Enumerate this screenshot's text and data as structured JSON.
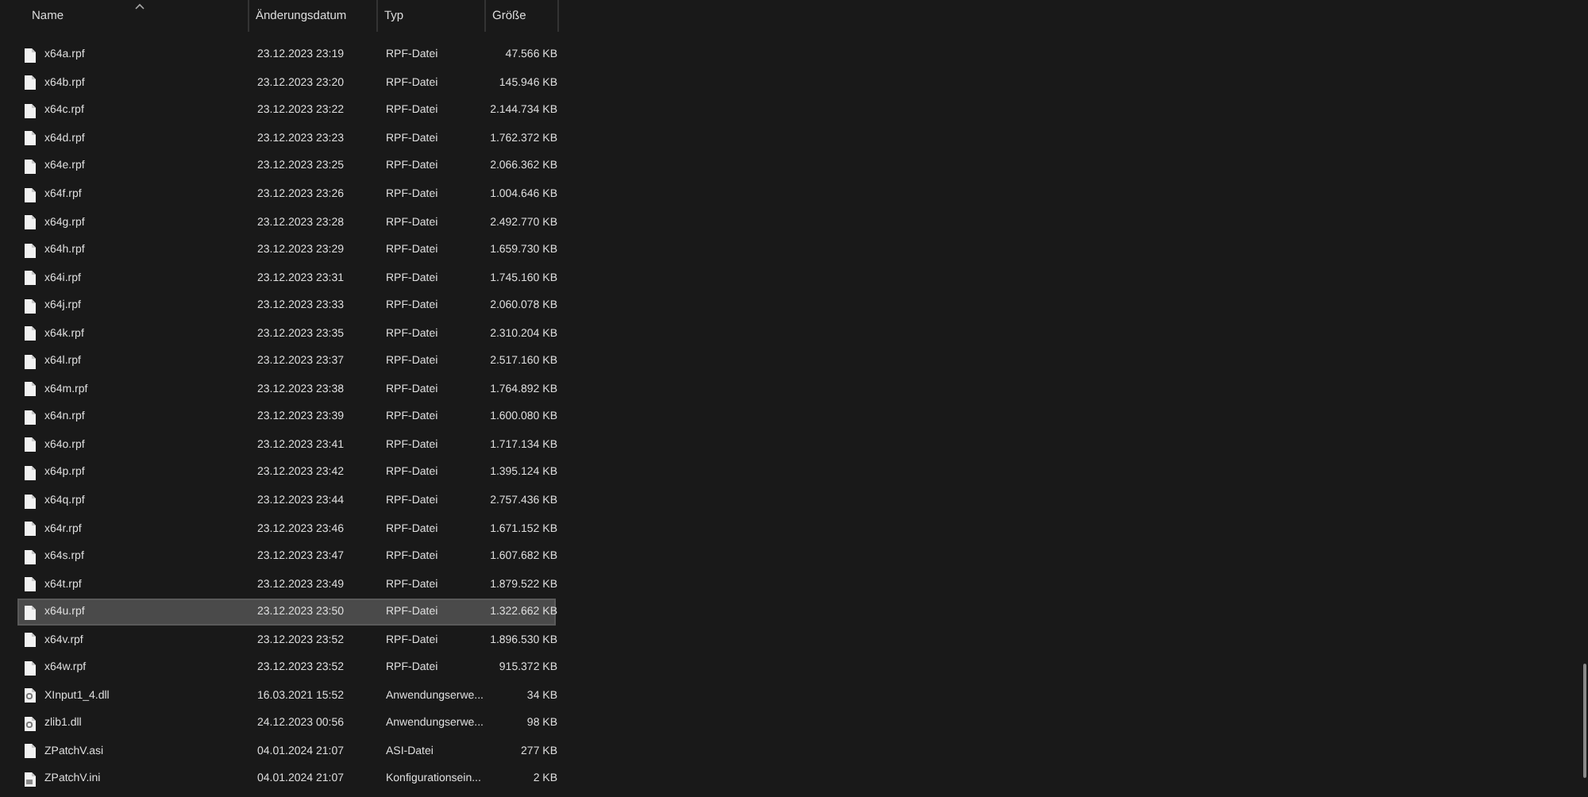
{
  "columns": [
    "Name",
    "Änderungsdatum",
    "Typ",
    "Größe"
  ],
  "rows": [
    {
      "name": "x64a.rpf",
      "date": "23.12.2023 23:19",
      "type": "RPF-Datei",
      "size": "47.566 KB",
      "kind": "file",
      "selected": false
    },
    {
      "name": "x64b.rpf",
      "date": "23.12.2023 23:20",
      "type": "RPF-Datei",
      "size": "145.946 KB",
      "kind": "file",
      "selected": false
    },
    {
      "name": "x64c.rpf",
      "date": "23.12.2023 23:22",
      "type": "RPF-Datei",
      "size": "2.144.734 KB",
      "kind": "file",
      "selected": false
    },
    {
      "name": "x64d.rpf",
      "date": "23.12.2023 23:23",
      "type": "RPF-Datei",
      "size": "1.762.372 KB",
      "kind": "file",
      "selected": false
    },
    {
      "name": "x64e.rpf",
      "date": "23.12.2023 23:25",
      "type": "RPF-Datei",
      "size": "2.066.362 KB",
      "kind": "file",
      "selected": false
    },
    {
      "name": "x64f.rpf",
      "date": "23.12.2023 23:26",
      "type": "RPF-Datei",
      "size": "1.004.646 KB",
      "kind": "file",
      "selected": false
    },
    {
      "name": "x64g.rpf",
      "date": "23.12.2023 23:28",
      "type": "RPF-Datei",
      "size": "2.492.770 KB",
      "kind": "file",
      "selected": false
    },
    {
      "name": "x64h.rpf",
      "date": "23.12.2023 23:29",
      "type": "RPF-Datei",
      "size": "1.659.730 KB",
      "kind": "file",
      "selected": false
    },
    {
      "name": "x64i.rpf",
      "date": "23.12.2023 23:31",
      "type": "RPF-Datei",
      "size": "1.745.160 KB",
      "kind": "file",
      "selected": false
    },
    {
      "name": "x64j.rpf",
      "date": "23.12.2023 23:33",
      "type": "RPF-Datei",
      "size": "2.060.078 KB",
      "kind": "file",
      "selected": false
    },
    {
      "name": "x64k.rpf",
      "date": "23.12.2023 23:35",
      "type": "RPF-Datei",
      "size": "2.310.204 KB",
      "kind": "file",
      "selected": false
    },
    {
      "name": "x64l.rpf",
      "date": "23.12.2023 23:37",
      "type": "RPF-Datei",
      "size": "2.517.160 KB",
      "kind": "file",
      "selected": false
    },
    {
      "name": "x64m.rpf",
      "date": "23.12.2023 23:38",
      "type": "RPF-Datei",
      "size": "1.764.892 KB",
      "kind": "file",
      "selected": false
    },
    {
      "name": "x64n.rpf",
      "date": "23.12.2023 23:39",
      "type": "RPF-Datei",
      "size": "1.600.080 KB",
      "kind": "file",
      "selected": false
    },
    {
      "name": "x64o.rpf",
      "date": "23.12.2023 23:41",
      "type": "RPF-Datei",
      "size": "1.717.134 KB",
      "kind": "file",
      "selected": false
    },
    {
      "name": "x64p.rpf",
      "date": "23.12.2023 23:42",
      "type": "RPF-Datei",
      "size": "1.395.124 KB",
      "kind": "file",
      "selected": false
    },
    {
      "name": "x64q.rpf",
      "date": "23.12.2023 23:44",
      "type": "RPF-Datei",
      "size": "2.757.436 KB",
      "kind": "file",
      "selected": false
    },
    {
      "name": "x64r.rpf",
      "date": "23.12.2023 23:46",
      "type": "RPF-Datei",
      "size": "1.671.152 KB",
      "kind": "file",
      "selected": false
    },
    {
      "name": "x64s.rpf",
      "date": "23.12.2023 23:47",
      "type": "RPF-Datei",
      "size": "1.607.682 KB",
      "kind": "file",
      "selected": false
    },
    {
      "name": "x64t.rpf",
      "date": "23.12.2023 23:49",
      "type": "RPF-Datei",
      "size": "1.879.522 KB",
      "kind": "file",
      "selected": false
    },
    {
      "name": "x64u.rpf",
      "date": "23.12.2023 23:50",
      "type": "RPF-Datei",
      "size": "1.322.662 KB",
      "kind": "file",
      "selected": true
    },
    {
      "name": "x64v.rpf",
      "date": "23.12.2023 23:52",
      "type": "RPF-Datei",
      "size": "1.896.530 KB",
      "kind": "file",
      "selected": false
    },
    {
      "name": "x64w.rpf",
      "date": "23.12.2023 23:52",
      "type": "RPF-Datei",
      "size": "915.372 KB",
      "kind": "file",
      "selected": false
    },
    {
      "name": "XInput1_4.dll",
      "date": "16.03.2021 15:52",
      "type": "Anwendungserwe...",
      "size": "34 KB",
      "kind": "dll",
      "selected": false
    },
    {
      "name": "zlib1.dll",
      "date": "24.12.2023 00:56",
      "type": "Anwendungserwe...",
      "size": "98 KB",
      "kind": "dll",
      "selected": false
    },
    {
      "name": "ZPatchV.asi",
      "date": "04.01.2024 21:07",
      "type": "ASI-Datei",
      "size": "277 KB",
      "kind": "file",
      "selected": false
    },
    {
      "name": "ZPatchV.ini",
      "date": "04.01.2024 21:07",
      "type": "Konfigurationsein...",
      "size": "2 KB",
      "kind": "ini",
      "selected": false
    }
  ]
}
